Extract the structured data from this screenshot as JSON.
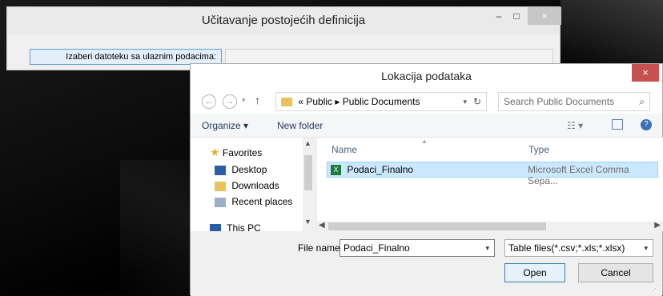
{
  "bgwindow": {
    "title": "Učitavanje postojećih definicija",
    "min": "–",
    "max": "□",
    "close": "×",
    "pick_button": "Izaberi datoteku sa ulaznim podacima:"
  },
  "dialog": {
    "title": "Lokacija podataka",
    "close": "×",
    "address": {
      "prefix": "«",
      "part1": "Public",
      "sep": "▸",
      "part2": "Public Documents"
    },
    "search_placeholder": "Search Public Documents",
    "toolbar": {
      "organize": "Organize ▾",
      "new_folder": "New folder"
    },
    "nav": {
      "favorites": "Favorites",
      "items": [
        "Desktop",
        "Downloads",
        "Recent places"
      ],
      "thispc": "This PC"
    },
    "columns": {
      "name": "Name",
      "type": "Type"
    },
    "files": [
      {
        "name": "Podaci_Finalno",
        "type": "Microsoft Excel Comma Sepa..."
      }
    ],
    "filename_label": "File name:",
    "filename_value": "Podaci_Finalno",
    "filter_value": "Table files(*.csv;*.xls;*.xlsx)",
    "open": "Open",
    "cancel": "Cancel"
  }
}
